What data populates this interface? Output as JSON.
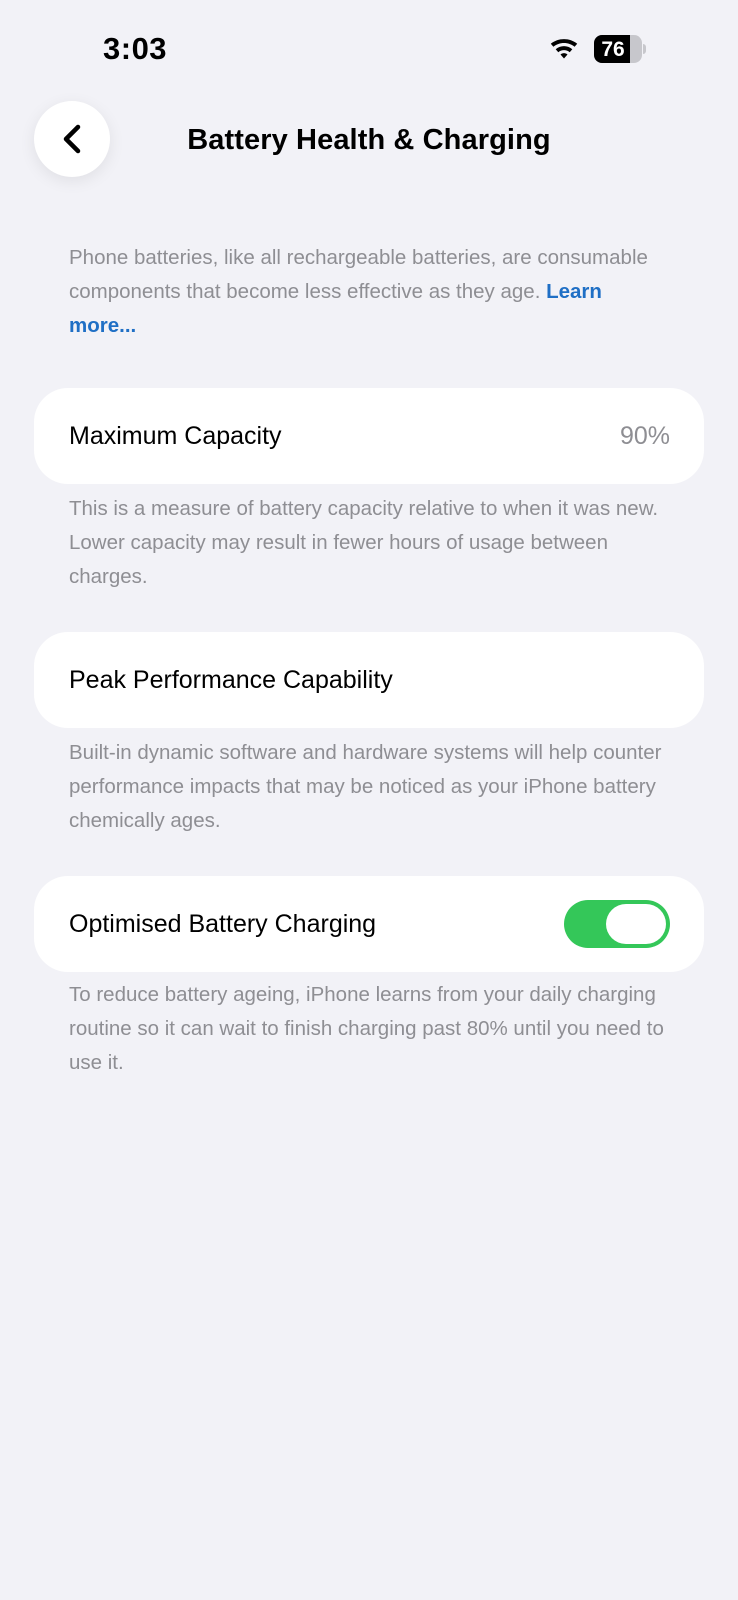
{
  "status_bar": {
    "time": "3:03",
    "battery_level": "76",
    "battery_percent": 76,
    "wifi_icon": "wifi-icon",
    "battery_icon": "battery-icon"
  },
  "header": {
    "back_icon": "chevron-left-icon",
    "title": "Battery Health & Charging"
  },
  "intro": {
    "text": "Phone batteries, like all rechargeable batteries, are consumable components that become less effective as they age.",
    "link": "Learn more..."
  },
  "maximum_capacity": {
    "label": "Maximum Capacity",
    "value": "90%",
    "footnote": "This is a measure of battery capacity relative to when it was new. Lower capacity may result in fewer hours of usage between charges."
  },
  "peak_performance": {
    "label": "Peak Performance Capability",
    "footnote": "Built-in dynamic software and hardware systems will help counter performance impacts that may be noticed as your iPhone battery chemically ages."
  },
  "optimised_charging": {
    "label": "Optimised Battery Charging",
    "enabled": true,
    "footnote": "To reduce battery ageing, iPhone learns from your daily charging routine so it can wait to finish charging past 80% until you need to use it."
  },
  "colors": {
    "background": "#f2f2f7",
    "card": "#ffffff",
    "secondary_text": "#8e8e93",
    "link": "#1f6fc5",
    "toggle_on": "#34c759"
  }
}
